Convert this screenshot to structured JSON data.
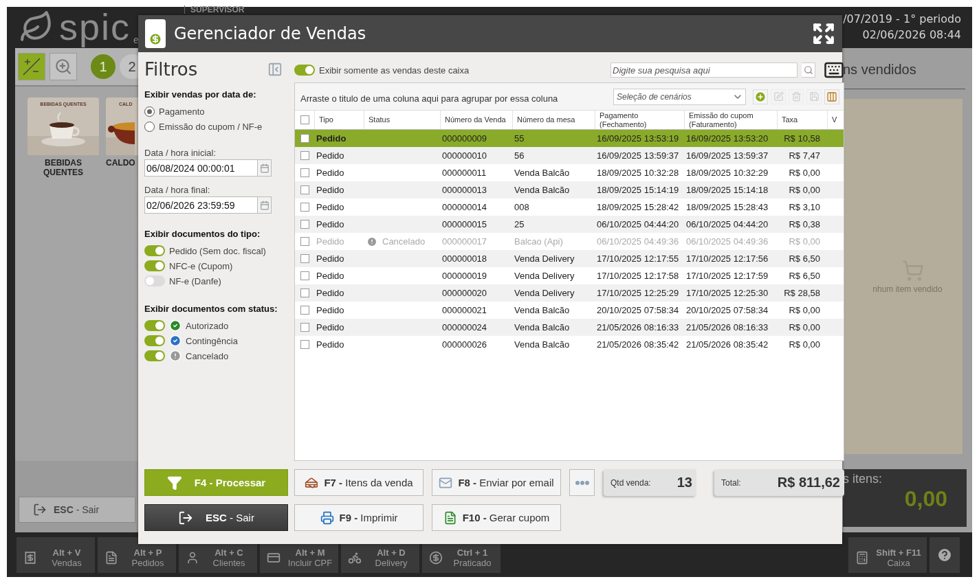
{
  "app": {
    "logo": "spic",
    "logo_suffix": "e",
    "user": "SUPERVISOR",
    "period": "/07/2019 - 1° periodo",
    "datetime": "02/06/2026 08:44",
    "pages": [
      {
        "label": "1",
        "selected": true
      },
      {
        "label": "2",
        "selected": false
      }
    ],
    "categories": [
      {
        "tile_label": "BEBIDAS QUENTES",
        "caption": "BEBIDAS QUENTES"
      },
      {
        "tile_label": "CALD",
        "caption": "CALDO"
      }
    ],
    "exit_button": "**ESC** - Sair",
    "items_panel": {
      "title": "ns vendidos",
      "empty_text": "nhum item vendido",
      "total_label": "s itens:",
      "total_value": "0,00"
    },
    "shortcuts": [
      {
        "key": "Alt + V",
        "label": "Vendas"
      },
      {
        "key": "Alt + P",
        "label": "Pedidos"
      },
      {
        "key": "Alt + C",
        "label": "Clientes"
      },
      {
        "key": "Alt + M",
        "label": "Incluir CPF"
      },
      {
        "key": "Alt + D",
        "label": "Delivery"
      },
      {
        "key": "Ctrl + 1",
        "label": "Praticado"
      }
    ],
    "register_shortcut": {
      "key": "Shift + F11",
      "label": "Caixa"
    }
  },
  "dialog": {
    "title": "Gerenciador de Vendas",
    "filters": {
      "title": "Filtros",
      "date_by": {
        "heading": "Exibir vendas por data de:",
        "options": [
          {
            "label": "Pagamento",
            "selected": true
          },
          {
            "label": "Emissão do cupom / NF-e",
            "selected": false
          }
        ]
      },
      "start": {
        "label": "Data / hora inicial:",
        "value": "06/08/2024 00:00:01"
      },
      "end": {
        "label": "Data / hora final:",
        "value": "02/06/2026 23:59:59"
      },
      "doc_types": {
        "heading": "Exibir documentos do tipo:",
        "items": [
          {
            "label": "Pedido (Sem doc. fiscal)",
            "on": true
          },
          {
            "label": "NFC-e (Cupom)",
            "on": true
          },
          {
            "label": "NF-e (Danfe)",
            "on": false
          }
        ]
      },
      "statuses": {
        "heading": "Exibir documentos com status:",
        "items": [
          {
            "label": "Autorizado",
            "on": true,
            "kind": "authorized"
          },
          {
            "label": "Contingência",
            "on": true,
            "kind": "contingency"
          },
          {
            "label": "Cancelado",
            "on": true,
            "kind": "cancelled"
          }
        ]
      }
    },
    "only_this_register": {
      "label": "Exibir somente as vendas deste caixa",
      "on": true
    },
    "search": {
      "placeholder": "Digite sua pesquisa aqui"
    },
    "group_hint": "Arraste o titulo de uma coluna aqui para agrupar por essa coluna",
    "scenarios": {
      "placeholder": "Seleção de cenários"
    },
    "grid_tools": [
      {
        "disabled": false
      },
      {
        "disabled": true
      },
      {
        "disabled": true
      },
      {
        "disabled": true
      },
      {
        "disabled": false
      }
    ],
    "table": {
      "all_checked": false,
      "columns": [
        "Tipo",
        "Status",
        "Número da Venda",
        "Número da mesa",
        "Pagamento (Fechamento)",
        "Emissão do cupom (Faturamento)",
        "Taxa",
        "V"
      ],
      "rows": [
        {
          "type": "Pedido",
          "number": "000000009",
          "table": "55",
          "paid": "16/09/2025 13:53:19",
          "issued": "16/09/2025 13:53:20",
          "fee": "R$ 10,58",
          "selected": true,
          "checked": false,
          "cancelled": false
        },
        {
          "type": "Pedido",
          "number": "000000010",
          "table": "56",
          "paid": "16/09/2025 13:59:37",
          "issued": "16/09/2025 13:59:37",
          "fee": "R$ 7,47",
          "selected": false,
          "checked": false,
          "cancelled": false
        },
        {
          "type": "Pedido",
          "number": "000000011",
          "table": "Venda Balcão",
          "paid": "18/09/2025 10:32:28",
          "issued": "18/09/2025 10:32:29",
          "fee": "R$ 0,00",
          "selected": false,
          "checked": false,
          "cancelled": false
        },
        {
          "type": "Pedido",
          "number": "000000013",
          "table": "Venda Balcão",
          "paid": "18/09/2025 15:14:19",
          "issued": "18/09/2025 15:14:18",
          "fee": "R$ 0,00",
          "selected": false,
          "checked": false,
          "cancelled": false
        },
        {
          "type": "Pedido",
          "number": "000000014",
          "table": "008",
          "paid": "18/09/2025 15:28:42",
          "issued": "18/09/2025 15:28:43",
          "fee": "R$ 3,10",
          "selected": false,
          "checked": false,
          "cancelled": false
        },
        {
          "type": "Pedido",
          "number": "000000015",
          "table": "25",
          "paid": "06/10/2025 04:44:20",
          "issued": "06/10/2025 04:44:20",
          "fee": "R$ 0,38",
          "selected": false,
          "checked": false,
          "cancelled": false
        },
        {
          "type": "Pedido",
          "status": "Cancelado",
          "number": "000000017",
          "table": "Balcao (Api)",
          "paid": "06/10/2025 04:49:36",
          "issued": "06/10/2025 04:49:36",
          "fee": "R$ 0,00",
          "selected": false,
          "checked": false,
          "cancelled": true
        },
        {
          "type": "Pedido",
          "number": "000000018",
          "table": "Venda Delivery",
          "paid": "17/10/2025 12:17:55",
          "issued": "17/10/2025 12:17:56",
          "fee": "R$ 6,50",
          "selected": false,
          "checked": false,
          "cancelled": false
        },
        {
          "type": "Pedido",
          "number": "000000019",
          "table": "Venda Delivery",
          "paid": "17/10/2025 12:17:58",
          "issued": "17/10/2025 12:17:59",
          "fee": "R$ 6,50",
          "selected": false,
          "checked": false,
          "cancelled": false
        },
        {
          "type": "Pedido",
          "number": "000000020",
          "table": "Venda Delivery",
          "paid": "17/10/2025 12:25:29",
          "issued": "17/10/2025 12:25:30",
          "fee": "R$ 28,58",
          "selected": false,
          "checked": false,
          "cancelled": false
        },
        {
          "type": "Pedido",
          "number": "000000021",
          "table": "Venda Balcão",
          "paid": "20/10/2025 07:58:34",
          "issued": "20/10/2025 07:58:34",
          "fee": "R$ 0,00",
          "selected": false,
          "checked": false,
          "cancelled": false
        },
        {
          "type": "Pedido",
          "number": "000000024",
          "table": "Venda Balcão",
          "paid": "21/05/2026 08:16:33",
          "issued": "21/05/2026 08:16:33",
          "fee": "R$ 0,00",
          "selected": false,
          "checked": false,
          "cancelled": false
        },
        {
          "type": "Pedido",
          "number": "000000026",
          "table": "Venda Balcão",
          "paid": "21/05/2026 08:35:42",
          "issued": "21/05/2026 08:35:42",
          "fee": "R$ 0,00",
          "selected": false,
          "checked": false,
          "cancelled": false
        }
      ]
    },
    "left_buttons": [
      {
        "label": "**F4 - Processar**",
        "kind": "primary"
      },
      {
        "label": "**ESC** - Sair",
        "kind": "dark"
      }
    ],
    "top_buttons": [
      {
        "label": "**F7 -** Itens da venda"
      },
      {
        "label": "**F8 -** Enviar por email"
      }
    ],
    "bottom_buttons": [
      {
        "label": "**F9 -** Imprimir"
      },
      {
        "label": "**F10 -** Gerar cupom"
      }
    ],
    "summary": [
      {
        "label": "Qtd venda:",
        "value": "13"
      },
      {
        "label": "Total:",
        "value": "R$ 811,62"
      }
    ]
  }
}
